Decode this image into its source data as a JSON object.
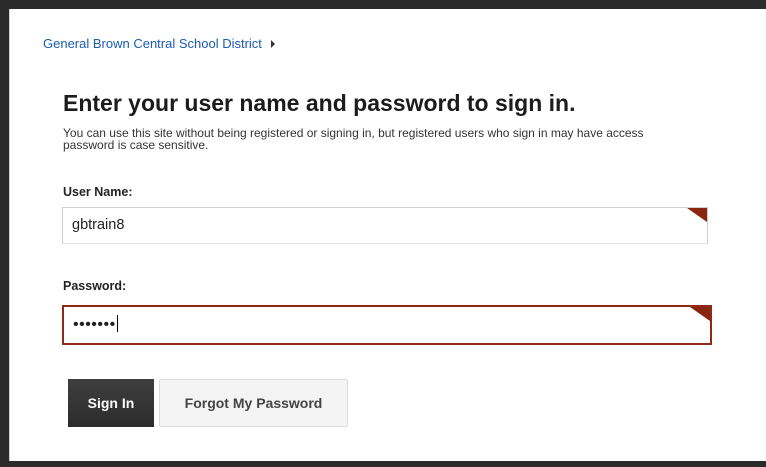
{
  "breadcrumb": {
    "site_link": "General Brown Central School District"
  },
  "page": {
    "title": "Enter your user name and password to sign in.",
    "intro_line1": "You can use this site without being registered or signing in, but registered users who sign in may have access",
    "intro_line2": "password is case sensitive."
  },
  "form": {
    "username_label": "User Name:",
    "username_value": "gbtrain8",
    "password_label": "Password:",
    "password_value_masked": "•••••••",
    "signin_label": "Sign In",
    "forgot_label": "Forgot My Password"
  },
  "colors": {
    "link": "#1a5bb5",
    "required_flag": "#8a2510",
    "focus_border": "#8e2a18"
  }
}
